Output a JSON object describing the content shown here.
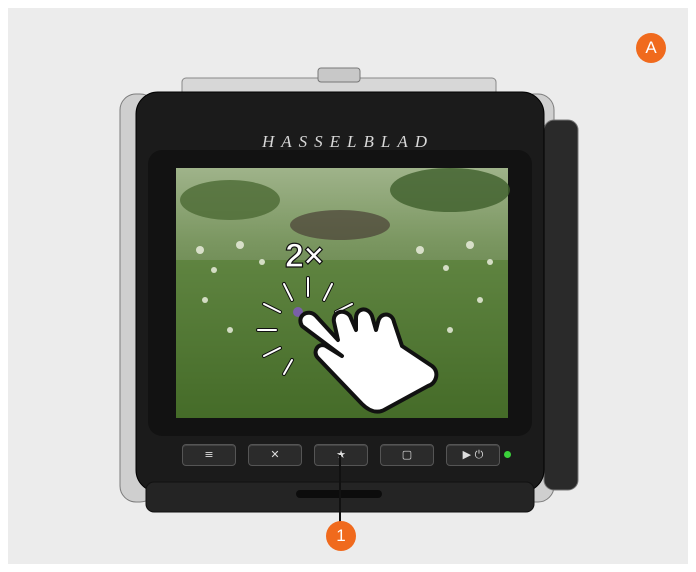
{
  "brand": "HASSELBLAD",
  "gesture_label": "2×",
  "callouts": {
    "a": "A",
    "one": "1"
  },
  "buttons": [
    {
      "name": "menu-button",
      "icon": "menu-icon",
      "glyph": "≡"
    },
    {
      "name": "close-button",
      "icon": "close-icon",
      "glyph": "✕"
    },
    {
      "name": "favorite-button",
      "icon": "star-icon",
      "glyph": "★"
    },
    {
      "name": "display-button",
      "icon": "screen-icon",
      "glyph": "▢"
    },
    {
      "name": "play-power-button",
      "icon": "play-power-icon",
      "glyph": "▶ ⏻"
    }
  ],
  "colors": {
    "accent": "#f06a1d",
    "led": "#3bd13b",
    "body": "#1b1b1b"
  }
}
